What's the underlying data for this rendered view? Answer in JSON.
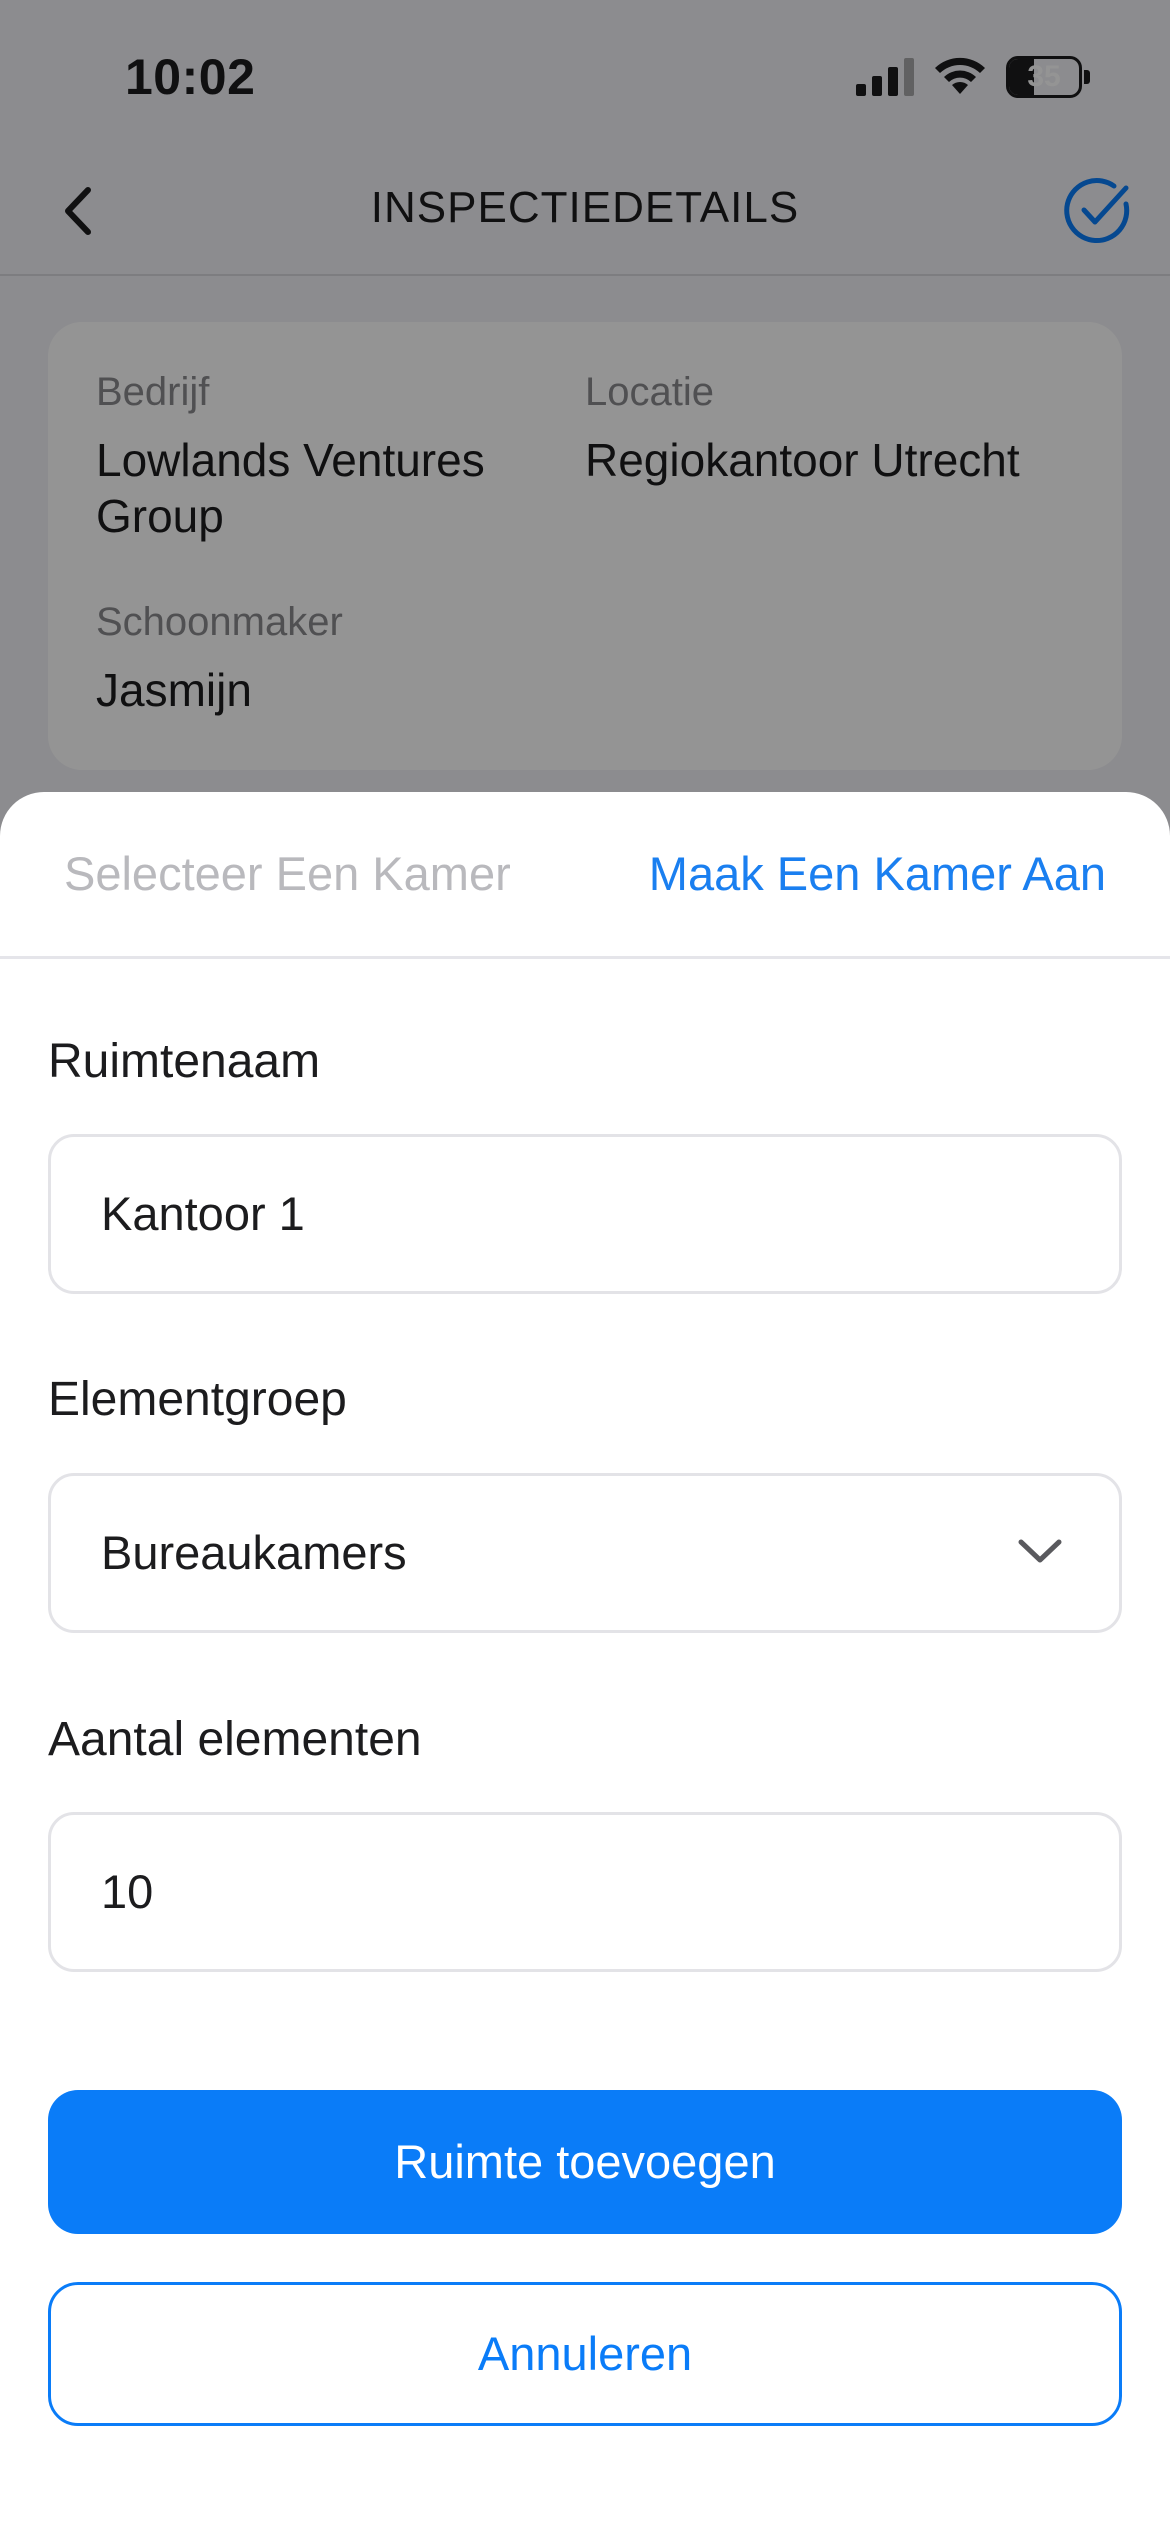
{
  "status_bar": {
    "time": "10:02",
    "battery_percent": "35",
    "icons": [
      "cellular-signal-icon",
      "wifi-icon",
      "battery-icon"
    ]
  },
  "navbar": {
    "title": "INSPECTIEDETAILS",
    "back_icon": "chevron-left-icon",
    "confirm_icon": "check-circle-icon"
  },
  "inspection": {
    "company_label": "Bedrijf",
    "company_value": "Lowlands Ventures Group",
    "location_label": "Locatie",
    "location_value": "Regiokantoor Utrecht",
    "cleaner_label": "Schoonmaker",
    "cleaner_value": "Jasmijn"
  },
  "sheet": {
    "tabs": {
      "select": "Selecteer Een Kamer",
      "create": "Maak Een Kamer Aan",
      "active": "create"
    },
    "room_name": {
      "label": "Ruimtenaam",
      "value": "Kantoor 1"
    },
    "element_group": {
      "label": "Elementgroep",
      "selected": "Bureaukamers",
      "icon": "chevron-down-icon"
    },
    "element_count": {
      "label": "Aantal elementen",
      "value": "10"
    },
    "add_button": "Ruimte toevoegen",
    "cancel_button": "Annuleren"
  },
  "colors": {
    "accent": "#0a7cf8",
    "tab_active": "#1a7ff0",
    "tab_inactive": "#b9b9bd",
    "overlay": "rgba(0,0,0,0.42)"
  }
}
